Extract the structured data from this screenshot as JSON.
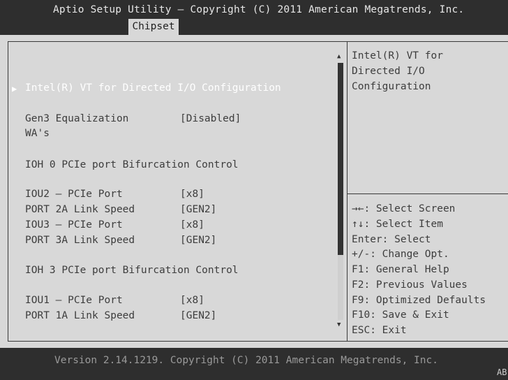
{
  "header": {
    "title": "Aptio Setup Utility – Copyright (C) 2011 American Megatrends, Inc.",
    "active_tab": "Chipset"
  },
  "menu": {
    "items": [
      {
        "label": "Intel(R) VT for Directed I/O Configuration",
        "submenu": true,
        "selected": true
      },
      {
        "label": "Gen3 Equalization",
        "label2": "WA's",
        "value": "[Disabled]"
      },
      {
        "label": "IOH 0 PCIe port Bifurcation Control"
      },
      {
        "label": "IOU2 – PCIe Port",
        "value": "[x8]"
      },
      {
        "label": "PORT 2A Link Speed",
        "value": "[GEN2]"
      },
      {
        "label": "IOU3 – PCIe Port",
        "value": "[x8]"
      },
      {
        "label": "PORT 3A Link Speed",
        "value": "[GEN2]"
      },
      {
        "label": "IOH 3 PCIe port Bifurcation Control"
      },
      {
        "label": "IOU1 – PCIe Port",
        "value": "[x8]"
      },
      {
        "label": "PORT 1A Link Speed",
        "value": "[GEN2]"
      }
    ]
  },
  "help": {
    "lines": [
      "Intel(R) VT for",
      "Directed I/O",
      "Configuration"
    ]
  },
  "keys": [
    "→←: Select Screen",
    "↑↓: Select Item",
    "Enter: Select",
    "+/-: Change Opt.",
    "F1: General Help",
    "F2: Previous Values",
    "F9: Optimized Defaults",
    "F10: Save & Exit",
    "ESC: Exit"
  ],
  "footer": {
    "text": "Version 2.14.1219. Copyright (C) 2011 American Megatrends, Inc.",
    "corner": "AB"
  },
  "scrollbar": {
    "up_arrow": "▲",
    "down_arrow": "▼"
  },
  "icons": {
    "submenu_arrow": "▶"
  }
}
